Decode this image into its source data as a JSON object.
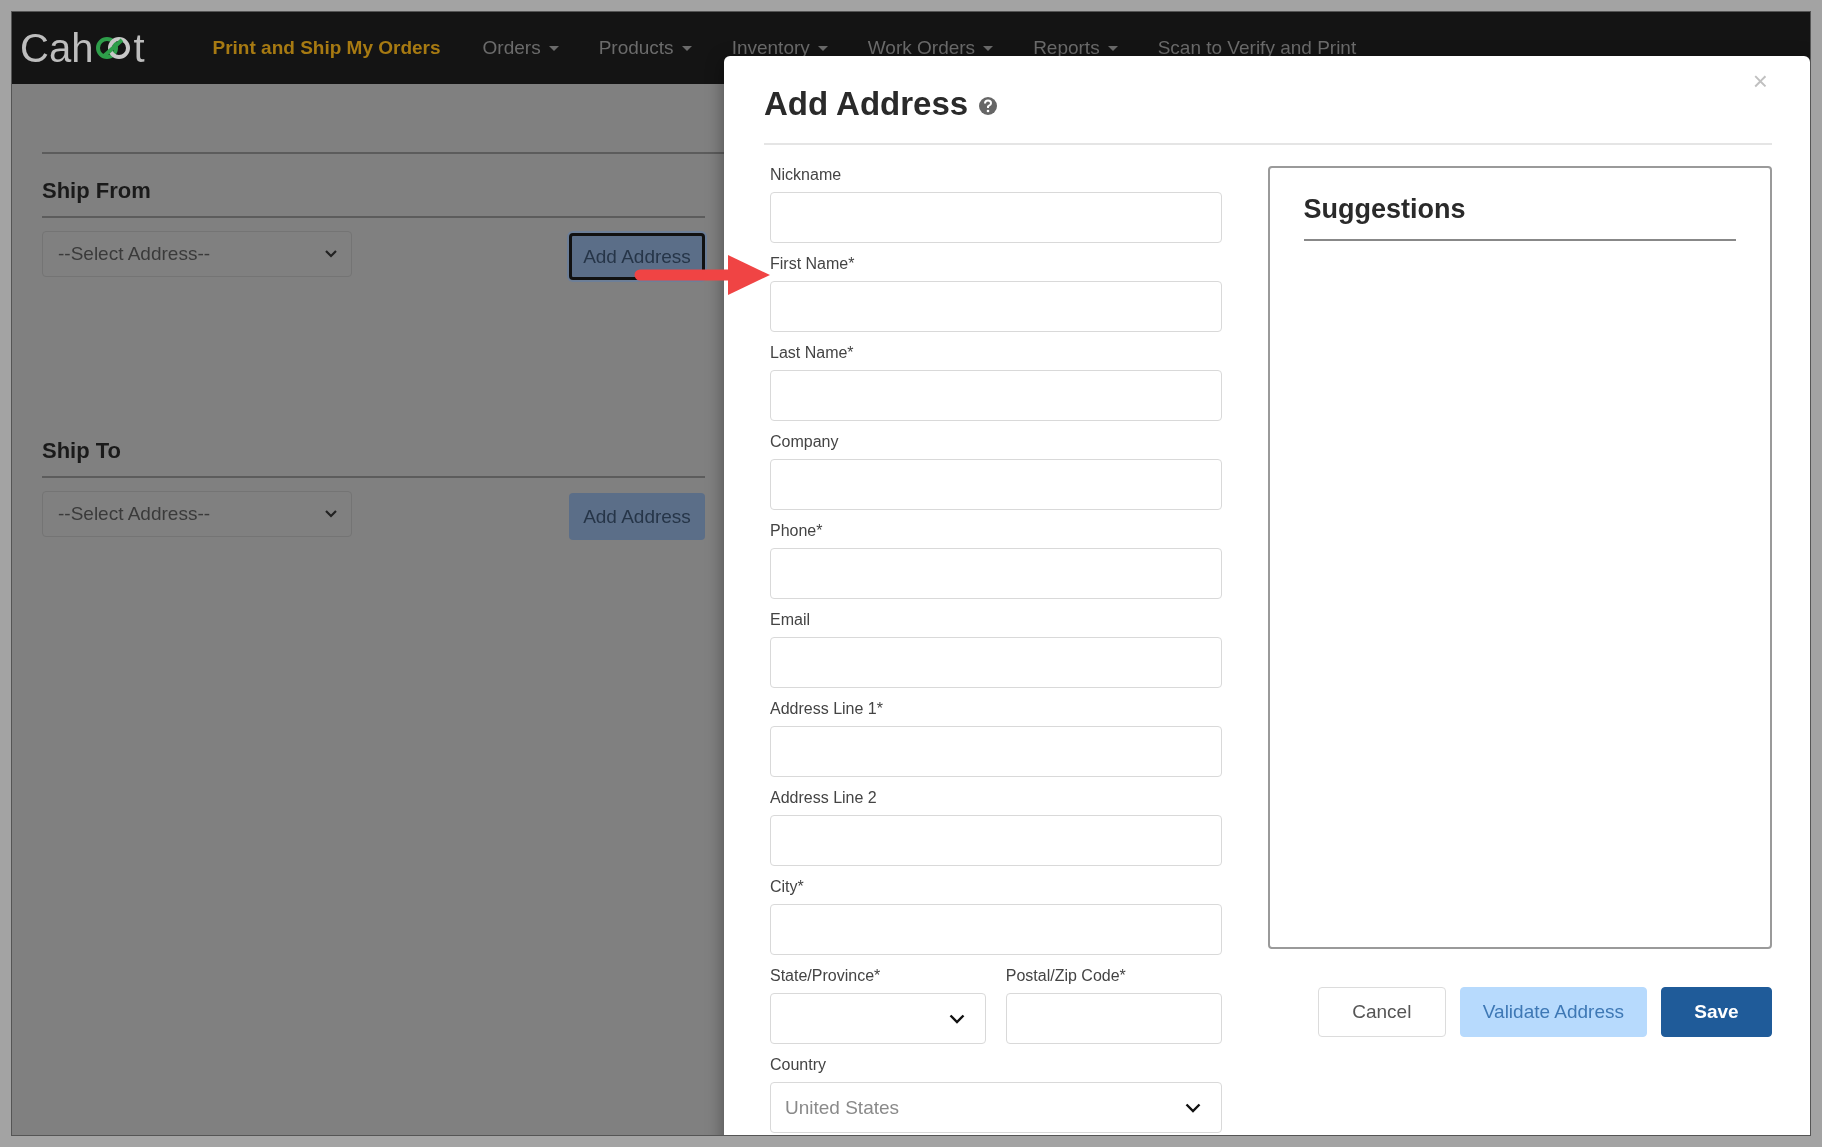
{
  "navbar": {
    "logo": {
      "before": "Cah",
      "after": "t"
    },
    "items": [
      {
        "label": "Print and Ship My Orders",
        "selected": true,
        "dropdown": false
      },
      {
        "label": "Orders",
        "selected": false,
        "dropdown": true
      },
      {
        "label": "Products",
        "selected": false,
        "dropdown": true
      },
      {
        "label": "Inventory",
        "selected": false,
        "dropdown": true
      },
      {
        "label": "Work Orders",
        "selected": false,
        "dropdown": true
      },
      {
        "label": "Reports",
        "selected": false,
        "dropdown": true
      },
      {
        "label": "Scan to Verify and Print",
        "selected": false,
        "dropdown": false
      }
    ]
  },
  "sections": [
    {
      "title": "Ship From",
      "select": "--Select Address--",
      "button": {
        "label": "Add Address",
        "focused": true
      }
    },
    {
      "title": "Ship To",
      "select": "--Select Address--",
      "button": {
        "label": "Add Address",
        "focused": false
      }
    }
  ],
  "modal": {
    "title": "Add Address",
    "close": "×",
    "rows": [
      {
        "fields": [
          {
            "label": "Nickname",
            "kind": "text"
          }
        ]
      },
      {
        "fields": [
          {
            "label": "First Name*",
            "kind": "text"
          }
        ]
      },
      {
        "fields": [
          {
            "label": "Last Name*",
            "kind": "text"
          }
        ]
      },
      {
        "fields": [
          {
            "label": "Company",
            "kind": "text"
          }
        ]
      },
      {
        "fields": [
          {
            "label": "Phone*",
            "kind": "text"
          }
        ]
      },
      {
        "fields": [
          {
            "label": "Email",
            "kind": "text"
          }
        ]
      },
      {
        "fields": [
          {
            "label": "Address Line 1*",
            "kind": "text"
          }
        ]
      },
      {
        "fields": [
          {
            "label": "Address Line 2",
            "kind": "text"
          }
        ]
      },
      {
        "fields": [
          {
            "label": "City*",
            "kind": "text"
          }
        ]
      },
      {
        "fields": [
          {
            "label": "State/Province*",
            "kind": "select"
          },
          {
            "label": "Postal/Zip Code*",
            "kind": "text"
          }
        ]
      },
      {
        "fields": [
          {
            "label": "Country",
            "kind": "select",
            "value": "United States",
            "disabled": true
          }
        ]
      }
    ],
    "suggestions": {
      "title": "Suggestions"
    },
    "buttons": [
      {
        "label": "Cancel",
        "kind": "default"
      },
      {
        "label": "Validate Address",
        "kind": "light"
      },
      {
        "label": "Save",
        "kind": "primary"
      }
    ]
  }
}
